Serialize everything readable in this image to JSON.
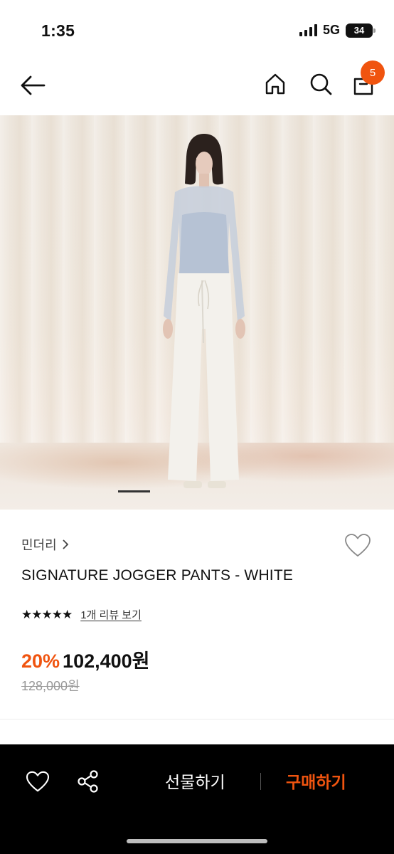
{
  "status_bar": {
    "time": "1:35",
    "network": "5G",
    "battery": "34"
  },
  "header": {
    "back_icon": "arrow-left-icon",
    "home_icon": "home-icon",
    "search_icon": "search-icon",
    "cart_icon": "shopping-bag-icon",
    "cart_count": "5"
  },
  "product": {
    "image_alt_icon": "product-photo",
    "brand": "민더리",
    "brand_chevron": "›",
    "title": "SIGNATURE JOGGER PANTS - WHITE",
    "rating_stars": "★★★★★",
    "review_link": "1개 리뷰 보기",
    "discount": "20%",
    "sale_price": "102,400원",
    "original_price": "128,000원",
    "slide_count_shown": "1"
  },
  "bottom_bar": {
    "wish_icon": "heart-icon",
    "share_icon": "share-icon",
    "gift_label": "선물하기",
    "buy_label": "구매하기"
  },
  "colors": {
    "accent": "#f0540f",
    "bar_bg": "#000000"
  }
}
